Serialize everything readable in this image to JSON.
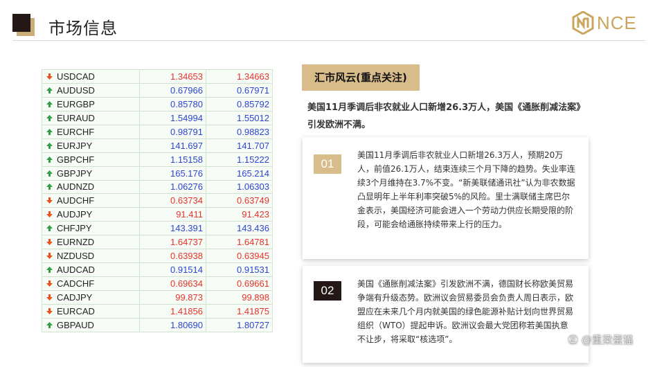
{
  "header": {
    "title": "市场信息",
    "logo_text": "NCE"
  },
  "quotes": [
    {
      "symbol": "USDCAD",
      "direction": "down",
      "bid": "1.34653",
      "ask": "1.34663"
    },
    {
      "symbol": "AUDUSD",
      "direction": "up",
      "bid": "0.67966",
      "ask": "0.67971"
    },
    {
      "symbol": "EURGBP",
      "direction": "up",
      "bid": "0.85780",
      "ask": "0.85792"
    },
    {
      "symbol": "EURAUD",
      "direction": "up",
      "bid": "1.54994",
      "ask": "1.55012"
    },
    {
      "symbol": "EURCHF",
      "direction": "up",
      "bid": "0.98791",
      "ask": "0.98823"
    },
    {
      "symbol": "EURJPY",
      "direction": "up",
      "bid": "141.697",
      "ask": "141.707"
    },
    {
      "symbol": "GBPCHF",
      "direction": "up",
      "bid": "1.15158",
      "ask": "1.15222"
    },
    {
      "symbol": "GBPJPY",
      "direction": "up",
      "bid": "165.176",
      "ask": "165.214"
    },
    {
      "symbol": "AUDNZD",
      "direction": "up",
      "bid": "1.06276",
      "ask": "1.06303"
    },
    {
      "symbol": "AUDCHF",
      "direction": "down",
      "bid": "0.63734",
      "ask": "0.63749"
    },
    {
      "symbol": "AUDJPY",
      "direction": "down",
      "bid": "91.411",
      "ask": "91.423"
    },
    {
      "symbol": "CHFJPY",
      "direction": "up",
      "bid": "143.391",
      "ask": "143.436"
    },
    {
      "symbol": "EURNZD",
      "direction": "down",
      "bid": "1.64737",
      "ask": "1.64781"
    },
    {
      "symbol": "NZDUSD",
      "direction": "down",
      "bid": "0.63938",
      "ask": "0.63945"
    },
    {
      "symbol": "AUDCAD",
      "direction": "up",
      "bid": "0.91514",
      "ask": "0.91531"
    },
    {
      "symbol": "CADCHF",
      "direction": "down",
      "bid": "0.69634",
      "ask": "0.69661"
    },
    {
      "symbol": "CADJPY",
      "direction": "down",
      "bid": "99.873",
      "ask": "99.898"
    },
    {
      "symbol": "EURCAD",
      "direction": "down",
      "bid": "1.41856",
      "ask": "1.41875"
    },
    {
      "symbol": "GBPAUD",
      "direction": "up",
      "bid": "1.80690",
      "ask": "1.80727"
    }
  ],
  "news": {
    "section_title": "汇市风云(重点关注)",
    "headline": "美国11月季调后非农就业人口新增26.3万人，美国《通胀削减法案》引发欧洲不满。",
    "items": [
      {
        "num": "01",
        "text": "美国11月季调后非农就业人口新增26.3万人，预期20万人，前值26.1万人，结束连续三个月下降的趋势。失业率连续3个月维持在3.7%不变。“新美联储通讯社”认为非农数据凸显明年上半年利率突破5%的风险。里士满联储主席巴尔金表示，美国经济可能会进入一个劳动力供应长期受限的阶段，可能会给通胀持续带来上行的压力。"
      },
      {
        "num": "02",
        "text": "美国《通胀削减法案》引发欧洲不满，德国财长称欧美贸易争端有升级态势。欧洲议会贸易委员会负责人周日表示，欧盟应在未来几个月内就美国的绿色能源补贴计划向世界贸易组织（WTO）提起申诉。欧洲议会最大党团称若美国执意不让步，将采取“核选项”。"
      }
    ]
  },
  "watermark": "㊣ @重梁蛋猫",
  "colors": {
    "gold": "#d8bd8a",
    "dark": "#231815",
    "price_up": "#2b45d4",
    "price_down": "#e8332a",
    "arrow_up": "#2f9e44",
    "arrow_down": "#e8501e"
  }
}
